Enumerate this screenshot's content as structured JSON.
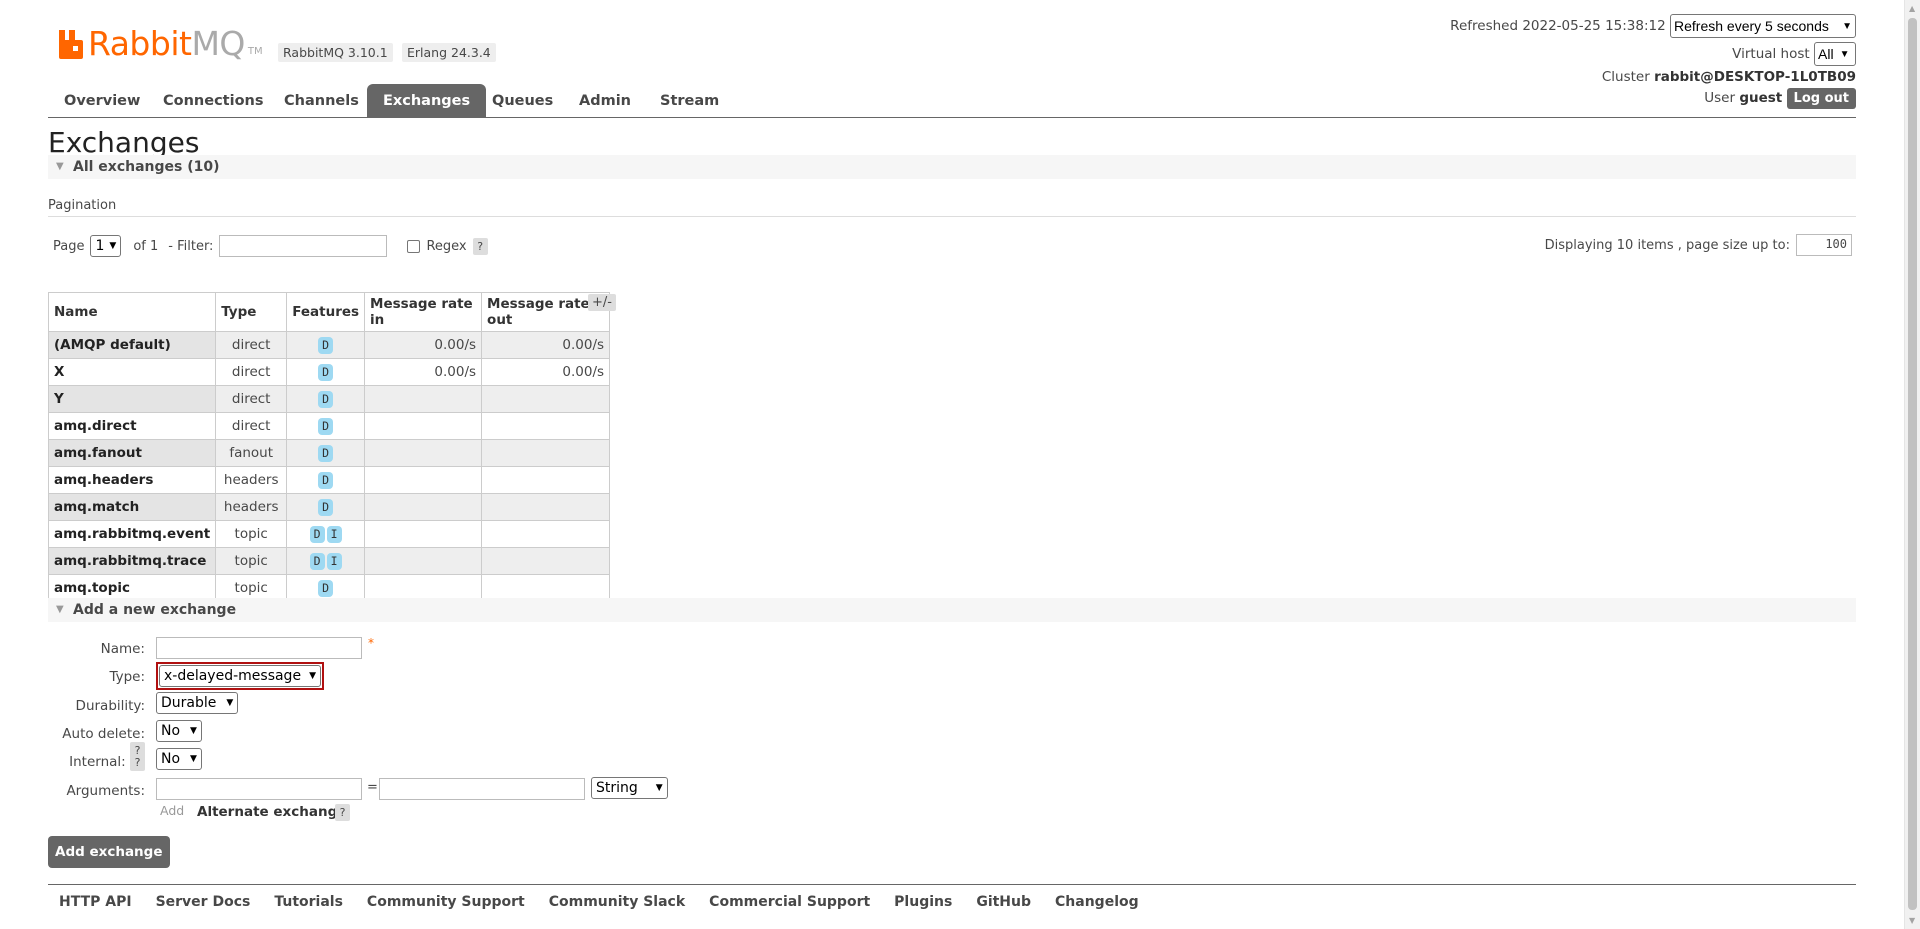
{
  "header": {
    "logo_rabbit": "Rabbit",
    "logo_mq": "MQ",
    "logo_tm": "TM",
    "version": "RabbitMQ 3.10.1",
    "erlang": "Erlang 24.3.4",
    "refreshed": "Refreshed 2022-05-25 15:38:12",
    "refresh_select": "Refresh every 5 seconds",
    "vhost_label": "Virtual host",
    "vhost_select": "All",
    "cluster_label": "Cluster",
    "cluster_name": "rabbit@DESKTOP-1L0TB09",
    "user_label": "User",
    "user_name": "guest",
    "logout": "Log out"
  },
  "tabs": [
    "Overview",
    "Connections",
    "Channels",
    "Exchanges",
    "Queues",
    "Admin",
    "Stream"
  ],
  "active_tab": "Exchanges",
  "page_title": "Exchanges",
  "all_section": "All exchanges (10)",
  "pagination": {
    "label": "Pagination",
    "page_label": "Page",
    "page_value": "1",
    "of_label": "of 1",
    "filter_label": "- Filter:",
    "regex_label": "Regex",
    "help": "?",
    "displaying": "Displaying 10 items , page size up to:",
    "page_size": "100"
  },
  "table": {
    "headers": [
      "Name",
      "Type",
      "Features",
      "Message rate in",
      "Message rate out"
    ],
    "plusminus": "+/-",
    "rows": [
      {
        "name": "(AMQP default)",
        "type": "direct",
        "features": [
          "D"
        ],
        "rate_in": "0.00/s",
        "rate_out": "0.00/s"
      },
      {
        "name": "X",
        "type": "direct",
        "features": [
          "D"
        ],
        "rate_in": "0.00/s",
        "rate_out": "0.00/s"
      },
      {
        "name": "Y",
        "type": "direct",
        "features": [
          "D"
        ],
        "rate_in": "",
        "rate_out": ""
      },
      {
        "name": "amq.direct",
        "type": "direct",
        "features": [
          "D"
        ],
        "rate_in": "",
        "rate_out": ""
      },
      {
        "name": "amq.fanout",
        "type": "fanout",
        "features": [
          "D"
        ],
        "rate_in": "",
        "rate_out": ""
      },
      {
        "name": "amq.headers",
        "type": "headers",
        "features": [
          "D"
        ],
        "rate_in": "",
        "rate_out": ""
      },
      {
        "name": "amq.match",
        "type": "headers",
        "features": [
          "D"
        ],
        "rate_in": "",
        "rate_out": ""
      },
      {
        "name": "amq.rabbitmq.event",
        "type": "topic",
        "features": [
          "D",
          "I"
        ],
        "rate_in": "",
        "rate_out": ""
      },
      {
        "name": "amq.rabbitmq.trace",
        "type": "topic",
        "features": [
          "D",
          "I"
        ],
        "rate_in": "",
        "rate_out": ""
      },
      {
        "name": "amq.topic",
        "type": "topic",
        "features": [
          "D"
        ],
        "rate_in": "",
        "rate_out": ""
      }
    ]
  },
  "add_section": "Add a new exchange",
  "form": {
    "name_label": "Name:",
    "required": "*",
    "type_label": "Type:",
    "type_value": "x-delayed-message",
    "durability_label": "Durability:",
    "durability_value": "Durable",
    "autodelete_label": "Auto delete:",
    "autodelete_value": "No",
    "internal_label": "Internal:",
    "internal_value": "No",
    "arguments_label": "Arguments:",
    "equals": "=",
    "arg_type": "String",
    "add_link": "Add",
    "alternate_exchange": "Alternate exchange",
    "help": "?",
    "submit": "Add exchange"
  },
  "footer": [
    "HTTP API",
    "Server Docs",
    "Tutorials",
    "Community Support",
    "Community Slack",
    "Commercial Support",
    "Plugins",
    "GitHub",
    "Changelog"
  ]
}
